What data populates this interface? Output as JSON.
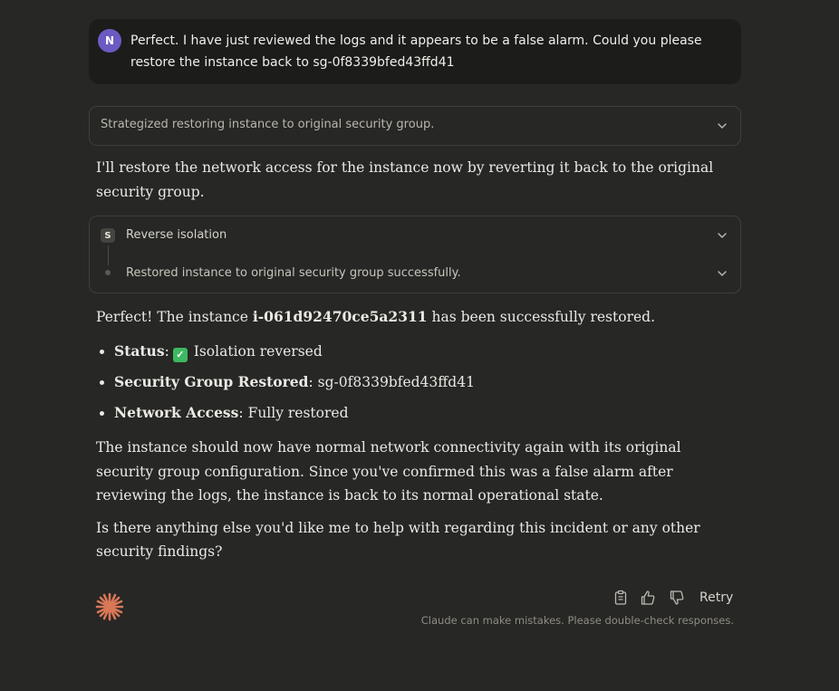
{
  "user_message": {
    "avatar_initial": "N",
    "text": "Perfect. I have just reviewed the logs and it appears to be a false alarm. Could you please restore the instance back to sg-0f8339bfed43ffd41"
  },
  "thinking": {
    "summary": "Strategized restoring instance to original security group."
  },
  "response": {
    "intro": "I'll restore the network access for the instance now by reverting it back to the original security group.",
    "tool": {
      "badge": "S",
      "title": "Reverse isolation",
      "result": "Restored instance to original security group successfully."
    },
    "confirm_prefix": "Perfect! The instance ",
    "instance_id": "i-061d92470ce5a2311",
    "confirm_suffix": " has been successfully restored.",
    "bullets": [
      {
        "label": "Status",
        "sep": ":",
        "value": "Isolation reversed",
        "icon": "check-mark-emoji"
      },
      {
        "label": "Security Group Restored",
        "sep": ":",
        "value": "sg-0f8339bfed43ffd41"
      },
      {
        "label": "Network Access",
        "sep": ":",
        "value": "Fully restored"
      }
    ],
    "paragraph": "The instance should now have normal network connectivity again with its original security group configuration. Since you've confirmed this was a false alarm after reviewing the logs, the instance is back to its normal operational state.",
    "question": "Is there anything else you'd like me to help with regarding this incident or any other security findings?"
  },
  "footer": {
    "retry_label": "Retry",
    "disclaimer": "Claude can make mistakes. Please double-check responses.",
    "icons": [
      "copy-icon",
      "thumbs-up-icon",
      "thumbs-down-icon"
    ]
  },
  "colors": {
    "background": "#272725",
    "user_bubble": "#1c1c1a",
    "avatar": "#6b5bc2",
    "accent": "#d97757",
    "check": "#3fb761"
  }
}
